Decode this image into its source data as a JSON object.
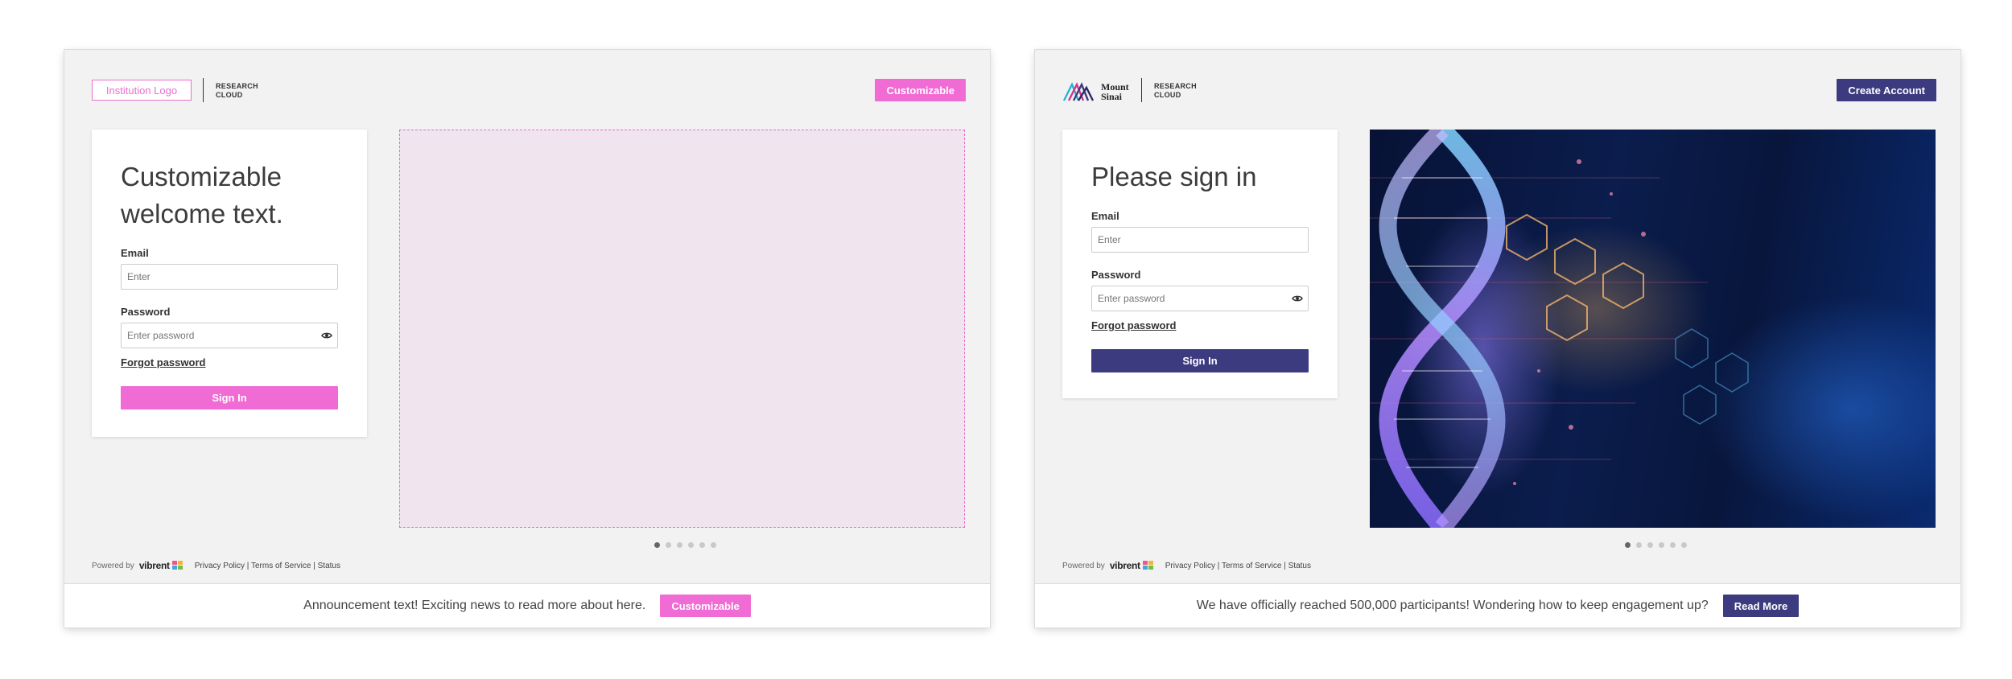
{
  "left": {
    "logo_text": "Institution Logo",
    "research_line1": "RESEARCH",
    "research_line2": "CLOUD",
    "header_button": "Customizable",
    "welcome_line1": "Customizable",
    "welcome_line2": "welcome text.",
    "email_label": "Email",
    "email_placeholder": "Enter",
    "password_label": "Password",
    "password_placeholder": "Enter password",
    "forgot": "Forgot password",
    "signin": "Sign In",
    "powered_by": "Powered by",
    "brand": "vibrent",
    "privacy": "Privacy Policy",
    "terms": "Terms of Service",
    "status": "Status",
    "sep": "|",
    "announcement": "Announcement text! Exciting news to read more about here.",
    "announcement_button": "Customizable",
    "carousel_active": 1,
    "carousel_count": 6,
    "accent": "#f06bd3"
  },
  "right": {
    "logo_line1": "Mount",
    "logo_line2": "Sinai",
    "research_line1": "RESEARCH",
    "research_line2": "CLOUD",
    "header_button": "Create Account",
    "welcome": "Please sign in",
    "email_label": "Email",
    "email_placeholder": "Enter",
    "password_label": "Password",
    "password_placeholder": "Enter password",
    "forgot": "Forgot password",
    "signin": "Sign In",
    "powered_by": "Powered by",
    "brand": "vibrent",
    "privacy": "Privacy Policy",
    "terms": "Terms of Service",
    "status": "Status",
    "sep": "|",
    "announcement": "We have officially reached 500,000 participants! Wondering how to keep engagement up?",
    "announcement_button": "Read More",
    "carousel_active": 1,
    "carousel_count": 6,
    "accent": "#3d3b7f"
  }
}
